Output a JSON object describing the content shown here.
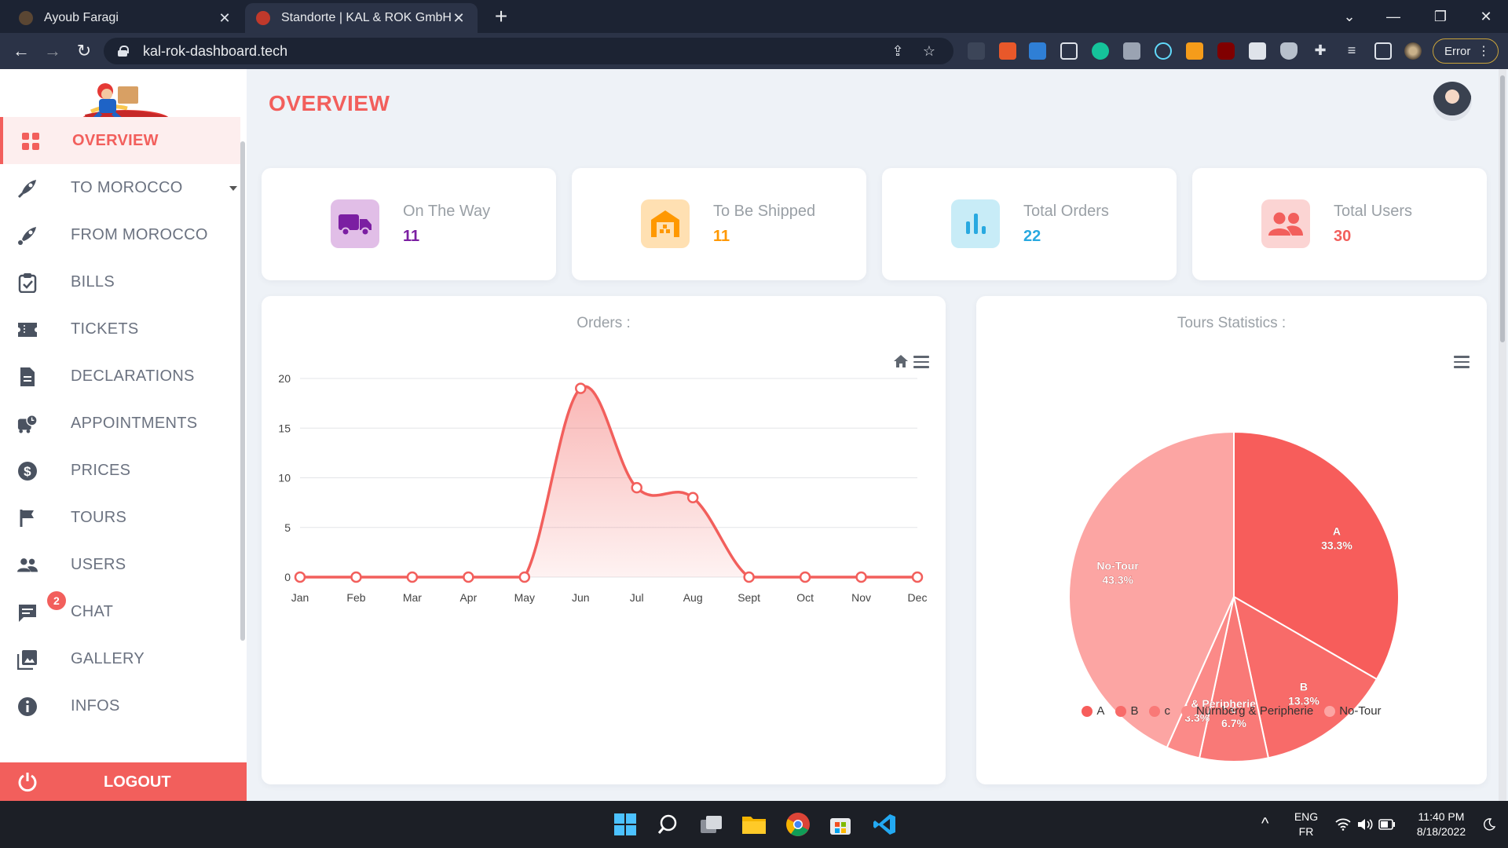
{
  "browser": {
    "tabs": [
      {
        "title": "Ayoub Faragi",
        "close": "✕",
        "active": false
      },
      {
        "title": "Standorte | KAL & ROK GmbH",
        "close": "✕",
        "active": true
      }
    ],
    "new_tab": "+",
    "window_controls": {
      "minimize": "—",
      "maximize": "❐",
      "close": "✕"
    },
    "url": "kal-rok-dashboard.tech",
    "error_pill": "Error",
    "menu": "⋮"
  },
  "sidebar": {
    "items": [
      {
        "label": "OVERVIEW",
        "icon": "grid-icon",
        "active": true
      },
      {
        "label": "TO MOROCCO",
        "icon": "rocket-icon",
        "has_caret": true
      },
      {
        "label": "FROM MOROCCO",
        "icon": "rocket-icon"
      },
      {
        "label": "BILLS",
        "icon": "clipboard-check-icon"
      },
      {
        "label": "TICKETS",
        "icon": "ticket-icon"
      },
      {
        "label": "DECLARATIONS",
        "icon": "document-icon"
      },
      {
        "label": "APPOINTMENTS",
        "icon": "bus-clock-icon"
      },
      {
        "label": "PRICES",
        "icon": "dollar-icon"
      },
      {
        "label": "TOURS",
        "icon": "flag-icon"
      },
      {
        "label": "USERS",
        "icon": "users-icon"
      },
      {
        "label": "CHAT",
        "icon": "chat-icon",
        "badge": "2"
      },
      {
        "label": "GALLERY",
        "icon": "gallery-icon"
      },
      {
        "label": "INFOS",
        "icon": "info-icon"
      }
    ],
    "logout": "LOGOUT"
  },
  "main": {
    "title": "OVERVIEW",
    "stats": [
      {
        "label": "On The Way",
        "value": "11",
        "icon": "truck-icon",
        "color": "#7b1fa2",
        "bg": "#e1bee7"
      },
      {
        "label": "To Be Shipped",
        "value": "11",
        "icon": "warehouse-icon",
        "color": "#ff9800",
        "bg": "#ffe0b2"
      },
      {
        "label": "Total Orders",
        "value": "22",
        "icon": "bar-chart-icon",
        "color": "#29a9e0",
        "bg": "#c8ecf7"
      },
      {
        "label": "Total Users",
        "value": "30",
        "icon": "users-icon",
        "color": "#f25f5c",
        "bg": "#fbd4d3"
      }
    ],
    "orders_chart_title": "Orders :",
    "tours_chart_title": "Tours Statistics :"
  },
  "chart_data": [
    {
      "type": "area",
      "title": "Orders :",
      "categories": [
        "Jan",
        "Feb",
        "Mar",
        "Apr",
        "May",
        "Jun",
        "Jul",
        "Aug",
        "Sept",
        "Oct",
        "Nov",
        "Dec"
      ],
      "values": [
        0,
        0,
        0,
        0,
        0,
        19,
        9,
        8,
        0,
        0,
        0,
        0
      ],
      "y_ticks": [
        "0",
        "5",
        "10",
        "15",
        "20"
      ],
      "ylim": [
        0,
        20
      ],
      "grid": true,
      "color": "#f25f5c"
    },
    {
      "type": "pie",
      "title": "Tours Statistics :",
      "slices": [
        {
          "name": "A",
          "value": 33.3,
          "label": "33.3%",
          "color": "#f75d5b"
        },
        {
          "name": "B",
          "value": 13.3,
          "label": "13.3%",
          "color": "#f86b69"
        },
        {
          "name": "c",
          "value": 6.7,
          "label": "6.7%",
          "color": "#f97977"
        },
        {
          "name": "Nürnberg & Peripherie",
          "value": 3.3,
          "label": "3.3%",
          "color": "#fb8a88"
        },
        {
          "name": "No-Tour",
          "value": 43.3,
          "label": "43.3%",
          "color": "#fca5a3"
        }
      ],
      "legend_position": "bottom"
    }
  ],
  "taskbar": {
    "lang": "ENG",
    "layout": "FR",
    "time": "11:40 PM",
    "date": "8/18/2022",
    "chevron": "^"
  }
}
